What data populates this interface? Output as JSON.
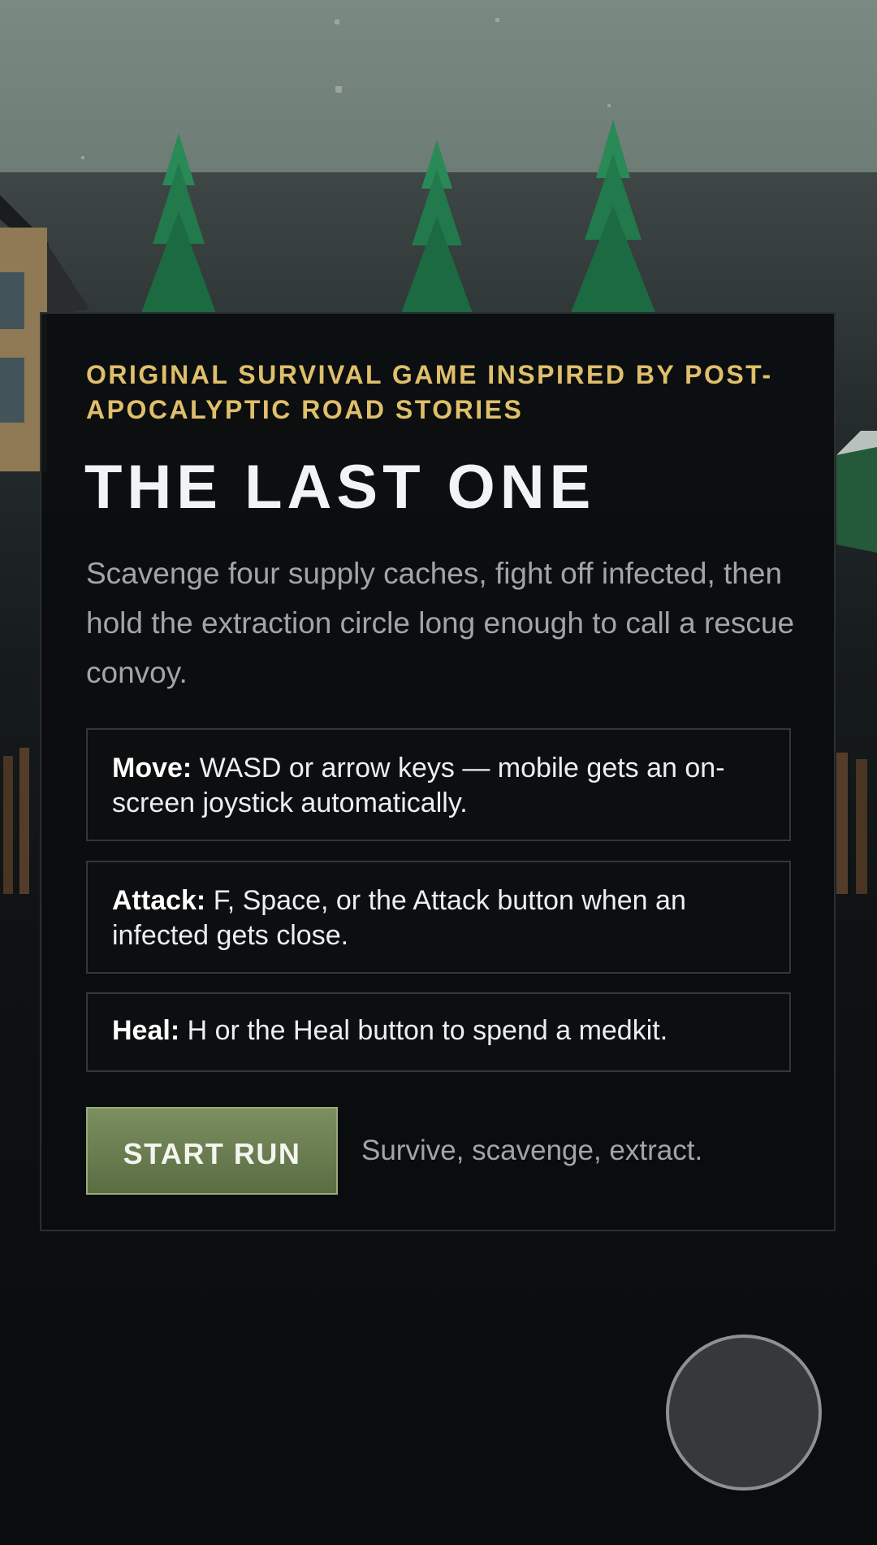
{
  "game": {
    "eyebrow": "ORIGINAL SURVIVAL GAME INSPIRED BY POST-APOCALYPTIC ROAD STORIES",
    "title": "THE LAST ONE",
    "description": "Scavenge four supply caches, fight off infected, then hold the extraction circle long enough to call a rescue convoy."
  },
  "controls": [
    {
      "label": "Move:",
      "text": " WASD or arrow keys — mobile gets an on-screen joystick automatically."
    },
    {
      "label": "Attack:",
      "text": " F, Space, or the Attack button when an infected gets close."
    },
    {
      "label": "Heal:",
      "text": " H or the Heal button to spend a medkit."
    }
  ],
  "actions": {
    "start_label": "START RUN",
    "tagline": "Survive, scavenge, extract."
  },
  "colors": {
    "accent_gold": "#e0bf6a",
    "button_green": "#6b7f52",
    "panel_bg": "#0b0d0f",
    "sky": "#76867e",
    "tree": "#1f7d4c"
  },
  "icons": {
    "joystick": "virtual-joystick-icon"
  }
}
